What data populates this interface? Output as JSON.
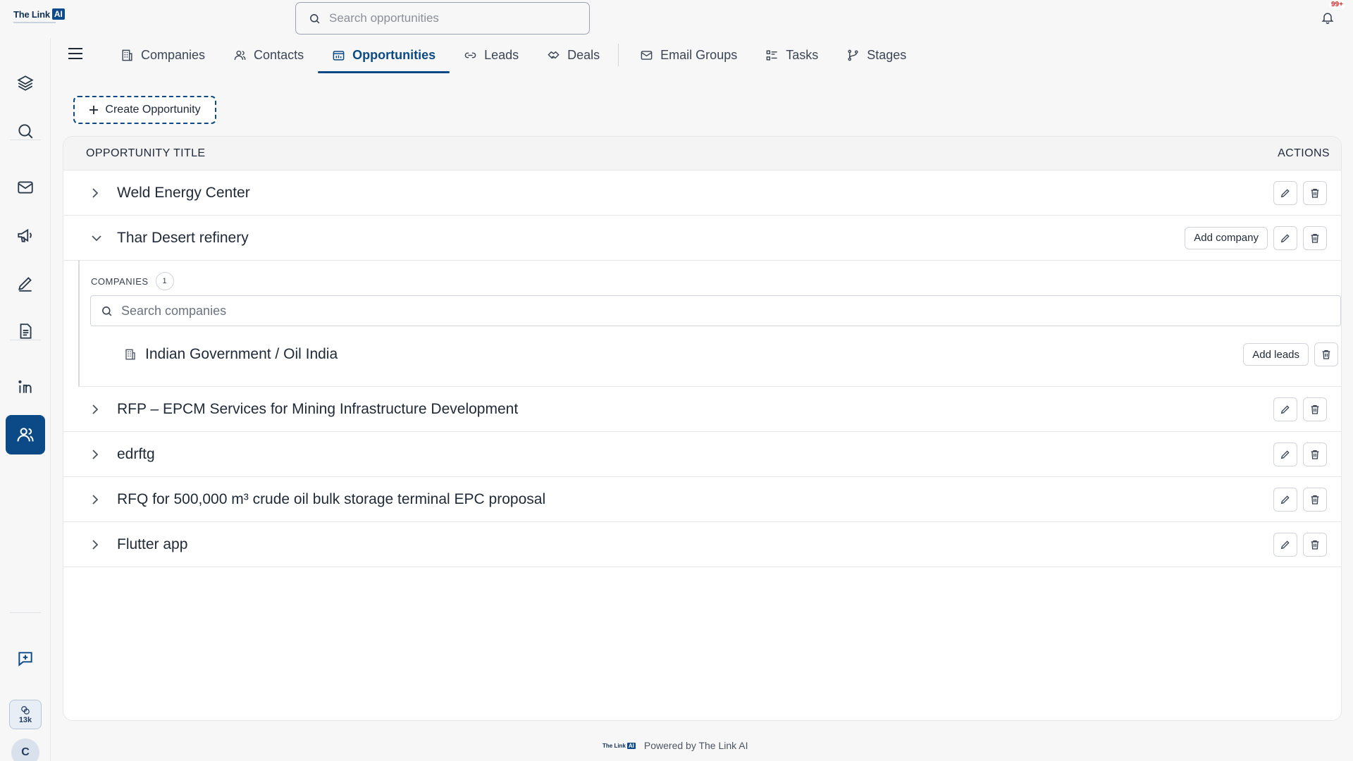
{
  "app": {
    "logo_text": "The Link",
    "logo_ai": "AI",
    "notification_badge": "99+"
  },
  "search": {
    "placeholder": "Search opportunities"
  },
  "sidebar": {
    "items": [
      {
        "icon": "layers-icon"
      },
      {
        "icon": "search-icon"
      },
      {
        "icon": "mail-icon"
      },
      {
        "icon": "megaphone-icon"
      },
      {
        "icon": "pen-icon"
      },
      {
        "icon": "document-icon"
      },
      {
        "icon": "linkedin-icon"
      },
      {
        "icon": "users-icon",
        "active": true
      }
    ],
    "credits": "13k",
    "avatar_initial": "C"
  },
  "tabs": [
    {
      "label": "Companies",
      "icon": "building-icon"
    },
    {
      "label": "Contacts",
      "icon": "contacts-icon"
    },
    {
      "label": "Opportunities",
      "icon": "opportunities-icon",
      "active": true
    },
    {
      "label": "Leads",
      "icon": "link-icon"
    },
    {
      "label": "Deals",
      "icon": "handshake-icon"
    },
    {
      "label": "Email Groups",
      "icon": "mail-icon"
    },
    {
      "label": "Tasks",
      "icon": "tasks-icon"
    },
    {
      "label": "Stages",
      "icon": "stages-icon"
    }
  ],
  "create_button": "Create Opportunity",
  "table": {
    "col_title": "OPPORTUNITY TITLE",
    "col_actions": "ACTIONS",
    "rows": [
      {
        "title": "Weld Energy Center",
        "expanded": false
      },
      {
        "title": "Thar Desert refinery",
        "expanded": true,
        "add_company": "Add company"
      },
      {
        "title": "RFP – EPCM Services for Mining Infrastructure Development",
        "expanded": false
      },
      {
        "title": "edrftg",
        "expanded": false
      },
      {
        "title": "RFQ for 500,000 m³ crude oil bulk storage terminal EPC proposal",
        "expanded": false
      },
      {
        "title": "Flutter app",
        "expanded": false
      }
    ]
  },
  "expanded": {
    "companies_label": "COMPANIES",
    "companies_count": "1",
    "search_placeholder": "Search companies",
    "companies": [
      {
        "name": "Indian Government / Oil India",
        "add_leads": "Add leads"
      }
    ]
  },
  "footer": {
    "text": "Powered by The Link AI",
    "logo_text": "The Link",
    "logo_ai": "AI"
  }
}
